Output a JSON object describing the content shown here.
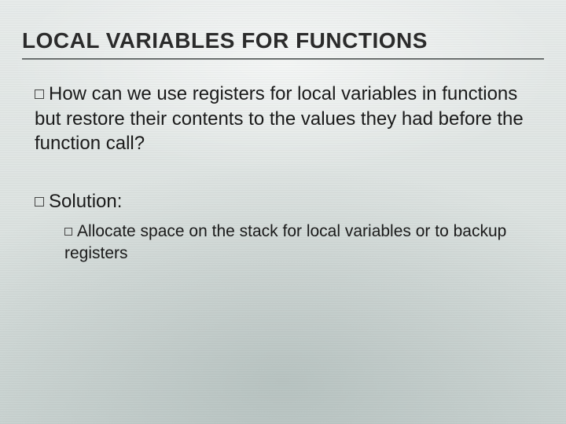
{
  "slide": {
    "title": "LOCAL VARIABLES FOR FUNCTIONS",
    "bullet1": "How can we use registers for local variables in functions but restore their contents to the values they had before the function call?",
    "bullet2": "Solution:",
    "sub1": "Allocate space on the stack for local variables or to backup registers"
  }
}
